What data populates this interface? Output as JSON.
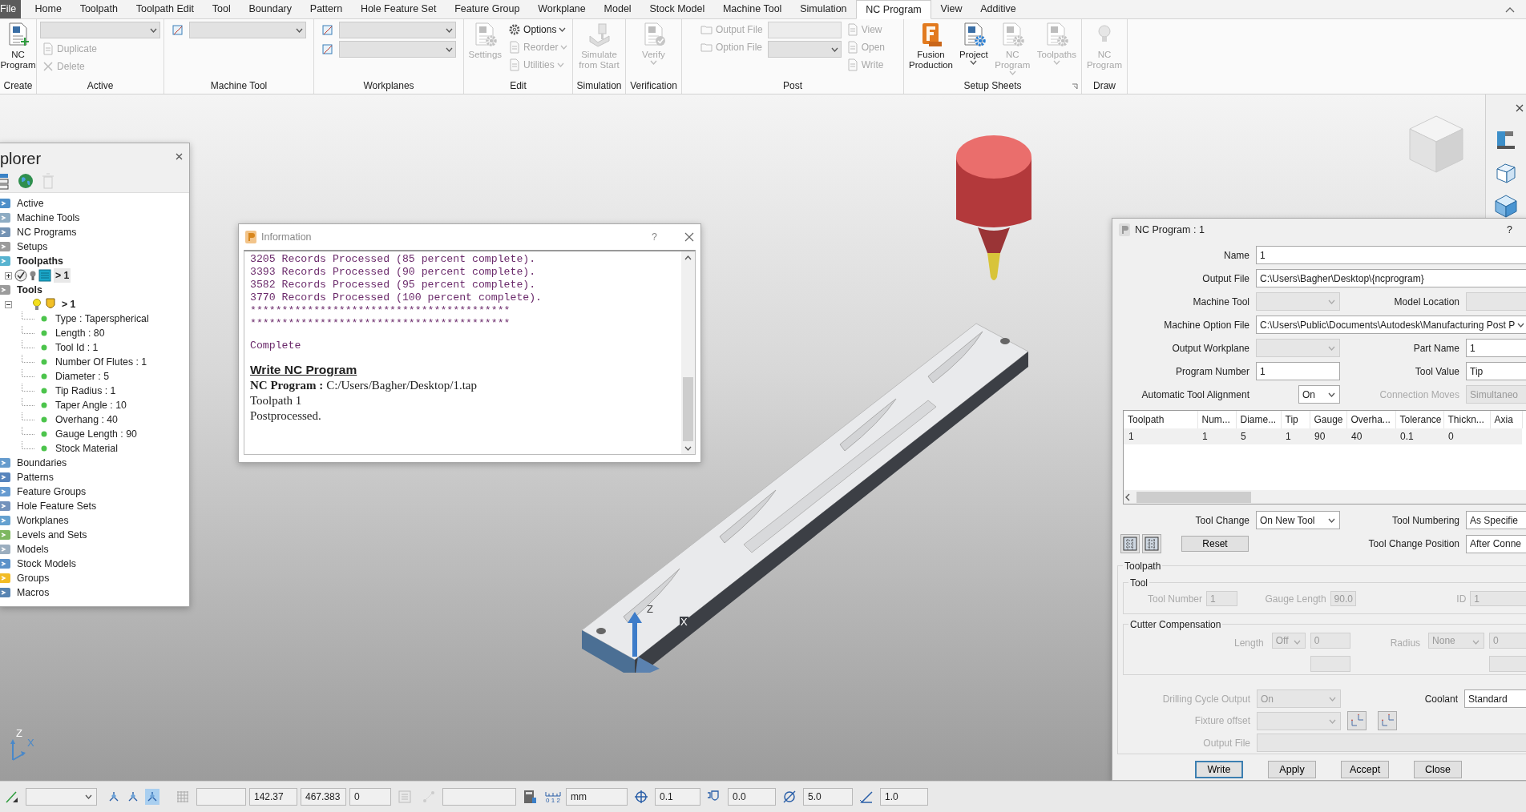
{
  "ribbon": {
    "tabs": [
      {
        "label": "File",
        "kind": "file",
        "selected": false
      },
      {
        "label": "Home",
        "selected": false
      },
      {
        "label": "Toolpath",
        "selected": false
      },
      {
        "label": "Toolpath Edit",
        "selected": false
      },
      {
        "label": "Tool",
        "selected": false
      },
      {
        "label": "Boundary",
        "selected": false
      },
      {
        "label": "Pattern",
        "selected": false
      },
      {
        "label": "Hole Feature Set",
        "selected": false
      },
      {
        "label": "Feature Group",
        "selected": false
      },
      {
        "label": "Workplane",
        "selected": false
      },
      {
        "label": "Model",
        "selected": false
      },
      {
        "label": "Stock Model",
        "selected": false
      },
      {
        "label": "Machine Tool",
        "selected": false
      },
      {
        "label": "Simulation",
        "selected": false
      },
      {
        "label": "NC Program",
        "selected": true
      },
      {
        "label": "View",
        "selected": false
      },
      {
        "label": "Additive",
        "selected": false
      }
    ],
    "groups": [
      {
        "label": "Create",
        "columns": [
          [
            {
              "kind": "large",
              "label": "NC Program",
              "disabled": false
            }
          ]
        ]
      },
      {
        "label": "Active",
        "columns": [
          [
            {
              "kind": "combo"
            },
            {
              "kind": "small",
              "label": "Duplicate",
              "disabled": true
            },
            {
              "kind": "small",
              "label": "Delete",
              "disabled": true
            }
          ]
        ]
      },
      {
        "label": "Machine Tool",
        "columns": [
          [
            {
              "kind": "icon_combo"
            }
          ]
        ]
      },
      {
        "label": "Workplanes",
        "columns": [
          [
            {
              "kind": "icon_combo"
            },
            {
              "kind": "icon_combo"
            }
          ]
        ]
      },
      {
        "label": "Edit",
        "columns": [
          [
            {
              "kind": "large",
              "label": "Settings",
              "disabled": true
            }
          ],
          [
            {
              "kind": "small",
              "label": "Options",
              "disabled": false,
              "menu": true
            },
            {
              "kind": "small",
              "label": "Reorder",
              "disabled": true,
              "menu": true
            },
            {
              "kind": "small",
              "label": "Utilities",
              "disabled": true,
              "menu": true
            }
          ]
        ]
      },
      {
        "label": "Simulation",
        "columns": [
          [
            {
              "kind": "large",
              "label": "Simulate from Start",
              "disabled": true
            }
          ]
        ]
      },
      {
        "label": "Verification",
        "columns": [
          [
            {
              "kind": "large",
              "label": "Verify",
              "disabled": true,
              "menu": true
            }
          ]
        ]
      },
      {
        "label": "Post",
        "columns": [
          [
            {
              "kind": "small",
              "label": "Output File",
              "disabled": true
            },
            {
              "kind": "small",
              "label": "Option File",
              "disabled": true
            }
          ],
          [
            {
              "kind": "field"
            },
            {
              "kind": "combo"
            }
          ],
          [
            {
              "kind": "small",
              "label": "View",
              "disabled": true
            },
            {
              "kind": "small",
              "label": "Open",
              "disabled": true
            },
            {
              "kind": "small",
              "label": "Write",
              "disabled": true
            }
          ]
        ]
      },
      {
        "label": "Setup Sheets",
        "launcher": true,
        "columns": [
          [
            {
              "kind": "large",
              "label": "Fusion Production",
              "disabled": false
            }
          ],
          [
            {
              "kind": "large",
              "label": "Project",
              "disabled": false,
              "menu": true
            }
          ],
          [
            {
              "kind": "large",
              "label": "NC Program",
              "disabled": true,
              "menu": true
            }
          ],
          [
            {
              "kind": "large",
              "label": "Toolpaths",
              "disabled": true,
              "menu": true
            }
          ]
        ]
      },
      {
        "label": "Draw",
        "columns": [
          [
            {
              "kind": "large",
              "label": "NC Program",
              "disabled": true
            }
          ]
        ]
      }
    ]
  },
  "explorer": {
    "title": "plorer",
    "tree": [
      {
        "label": "Active"
      },
      {
        "label": "Machine Tools"
      },
      {
        "label": "NC Programs"
      },
      {
        "label": "Setups"
      },
      {
        "label": "Toolpaths",
        "bold": true,
        "children": [
          {
            "label": "> 1",
            "kind": "toolpath",
            "bold": true,
            "expanded": false,
            "selected": true
          }
        ]
      },
      {
        "label": "Tools",
        "bold": true,
        "children": [
          {
            "label": "> 1",
            "kind": "tool",
            "bold": true,
            "expanded": true,
            "selected": false,
            "children": [
              {
                "label": "Type : Taperspherical"
              },
              {
                "label": "Length : 80"
              },
              {
                "label": "Tool Id : 1"
              },
              {
                "label": "Number Of Flutes : 1"
              },
              {
                "label": "Diameter : 5"
              },
              {
                "label": "Tip Radius : 1"
              },
              {
                "label": "Taper Angle : 10"
              },
              {
                "label": "Overhang : 40"
              },
              {
                "label": "Gauge Length : 90"
              },
              {
                "label": "Stock Material"
              }
            ]
          }
        ]
      },
      {
        "label": "Boundaries"
      },
      {
        "label": "Patterns"
      },
      {
        "label": "Feature Groups"
      },
      {
        "label": "Hole Feature Sets"
      },
      {
        "label": "Workplanes"
      },
      {
        "label": "Levels and Sets"
      },
      {
        "label": "Models"
      },
      {
        "label": "Stock Models"
      },
      {
        "label": "Groups"
      },
      {
        "label": "Macros"
      }
    ]
  },
  "info_dialog": {
    "title": "Information",
    "help": "?",
    "lines": [
      {
        "kind": "log",
        "text": "3205 Records Processed (85 percent complete)."
      },
      {
        "kind": "log",
        "text": "3393 Records Processed (90 percent complete)."
      },
      {
        "kind": "log",
        "text": "3582 Records Processed (95 percent complete)."
      },
      {
        "kind": "log",
        "text": "3770 Records Processed (100 percent complete)."
      },
      {
        "kind": "log",
        "text": "*****************************************"
      },
      {
        "kind": "log",
        "text": "*****************************************"
      },
      {
        "kind": "status",
        "text": "Complete"
      },
      {
        "kind": "heading",
        "text": "Write NC Program"
      },
      {
        "kind": "text",
        "text": "**NC Program :** C:/Users/Bagher/Desktop/1.tap"
      },
      {
        "kind": "text",
        "text": "Toolpath 1"
      },
      {
        "kind": "text",
        "text": "Postprocessed."
      }
    ]
  },
  "viewport": {
    "model_axes": {
      "z": "Z",
      "x": "X"
    },
    "corner_axes": {
      "z": "Z",
      "x": "X"
    }
  },
  "nc_dialog": {
    "title": "NC Program : 1",
    "help": "?",
    "rows": [
      {
        "kind": "wide",
        "label": "Name",
        "control": {
          "kind": "text",
          "value": "1"
        }
      },
      {
        "kind": "wide",
        "label": "Output File",
        "control": {
          "kind": "text",
          "value": "C:\\Users\\Bagher\\Desktop\\{ncprogram}"
        }
      },
      {
        "kind": "pair",
        "left": {
          "label": "Machine Tool",
          "control": {
            "kind": "combo",
            "disabled": true
          }
        },
        "right": {
          "label": "Model Location",
          "control": {
            "kind": "text",
            "disabled": true
          }
        }
      },
      {
        "kind": "wide",
        "label": "Machine Option File",
        "control": {
          "kind": "combo",
          "value": "C:\\Users\\Public\\Documents\\Autodesk\\Manufacturing Post P"
        }
      },
      {
        "kind": "pair",
        "left": {
          "label": "Output Workplane",
          "control": {
            "kind": "combo",
            "disabled": true
          }
        },
        "right": {
          "label": "Part Name",
          "control": {
            "kind": "text",
            "value": "1"
          }
        }
      },
      {
        "kind": "pair",
        "left": {
          "label": "Program Number",
          "control": {
            "kind": "text",
            "value": "1"
          }
        },
        "right": {
          "label": "Tool Value",
          "control": {
            "kind": "text",
            "value": "Tip"
          }
        }
      },
      {
        "kind": "pair",
        "left": {
          "label": "Automatic Tool Alignment",
          "control": {
            "kind": "combo_small",
            "value": "On"
          }
        },
        "right": {
          "label": "Connection Moves",
          "disabled": true,
          "control": {
            "kind": "text",
            "value": "Simultaneo",
            "disabled": true
          }
        }
      }
    ],
    "table": {
      "columns": [
        "Toolpath",
        "Num...",
        "Diame...",
        "Tip",
        "Gauge",
        "Overha...",
        "Tolerance",
        "Thickn...",
        "Axia"
      ],
      "rows": [
        [
          "1",
          "1",
          "5",
          "1",
          "90",
          "40",
          "0.1",
          "0"
        ]
      ]
    },
    "rows2": [
      {
        "kind": "pair",
        "left": {
          "label": "Tool Change",
          "control": {
            "kind": "combo",
            "value": "On New Tool"
          }
        },
        "right": {
          "label": "Tool Numbering",
          "control": {
            "kind": "text",
            "value": "As Specifie"
          }
        }
      },
      {
        "kind": "buttons",
        "button": "Reset",
        "right": {
          "label": "Tool Change Position",
          "control": {
            "kind": "text",
            "value": "After Conne"
          }
        }
      }
    ],
    "toolpath_section": {
      "title": "Toolpath",
      "tool_group": {
        "title": "Tool",
        "disabled": true,
        "fields": [
          {
            "label": "Tool Number",
            "value": "1"
          },
          {
            "label": "Gauge Length",
            "value": "90.0"
          },
          {
            "label": "ID",
            "value": "1"
          }
        ]
      },
      "cutter_group": {
        "title": "Cutter Compensation",
        "disabled": true,
        "fields": [
          {
            "label": "Length",
            "mode": "Off",
            "value": "0"
          },
          {
            "label": "Radius",
            "mode": "None",
            "value": "0"
          }
        ]
      },
      "rows": [
        {
          "kind": "pair",
          "left": {
            "label": "Drilling Cycle Output",
            "disabled": true,
            "control": {
              "kind": "combo",
              "value": "On",
              "disabled": true
            }
          },
          "right": {
            "label": "Coolant",
            "control": {
              "kind": "text",
              "value": "Standard"
            }
          }
        },
        {
          "kind": "fixture",
          "label": "Fixture offset",
          "disabled": true
        },
        {
          "kind": "wide",
          "label": "Output File",
          "disabled": true,
          "control": {
            "kind": "text",
            "disabled": true
          }
        }
      ]
    },
    "buttons": [
      {
        "label": "Write",
        "default": true
      },
      {
        "label": "Apply",
        "default": false
      },
      {
        "label": "Accept",
        "default": false
      },
      {
        "label": "Close",
        "default": false
      }
    ]
  },
  "status_bar": [
    {
      "kind": "icon"
    },
    {
      "kind": "combo"
    },
    {
      "kind": "toggles",
      "items": [
        {
          "on": false
        },
        {
          "on": false
        },
        {
          "on": true
        }
      ]
    },
    {
      "kind": "icon"
    },
    {
      "kind": "field"
    },
    {
      "kind": "field",
      "value": "142.37"
    },
    {
      "kind": "field",
      "value": "467.383"
    },
    {
      "kind": "field",
      "value": "0"
    },
    {
      "kind": "icon"
    },
    {
      "kind": "icon"
    },
    {
      "kind": "field"
    },
    {
      "kind": "icon"
    },
    {
      "kind": "ruler",
      "label": "0 1 2"
    },
    {
      "kind": "field",
      "value": "mm"
    },
    {
      "kind": "icon"
    },
    {
      "kind": "field",
      "value": "0.1"
    },
    {
      "kind": "icon"
    },
    {
      "kind": "field",
      "value": "0.0"
    },
    {
      "kind": "icon"
    },
    {
      "kind": "field",
      "value": "5.0"
    },
    {
      "kind": "icon"
    },
    {
      "kind": "field",
      "value": "1.0"
    }
  ]
}
